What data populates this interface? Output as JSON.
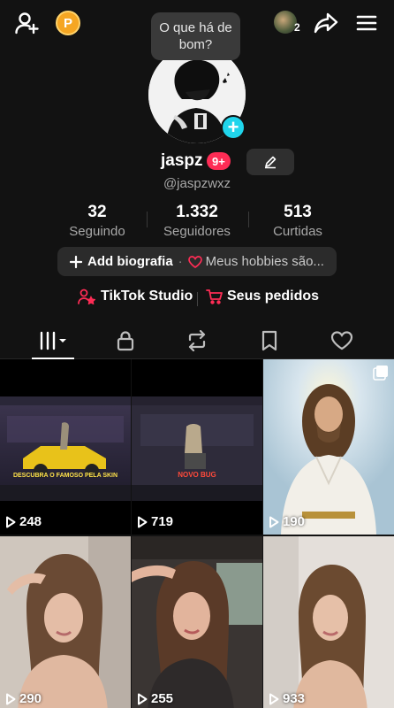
{
  "topbar": {
    "coin_label": "P",
    "bubble_text": "O que há de bom?",
    "notification_count": "2"
  },
  "profile": {
    "username": "jaspz",
    "badge": "9+",
    "handle": "@jaspzwxz"
  },
  "stats": [
    {
      "value": "32",
      "label": "Seguindo"
    },
    {
      "value": "1.332",
      "label": "Seguidores"
    },
    {
      "value": "513",
      "label": "Curtidas"
    }
  ],
  "bio": {
    "add_label": "Add biografia",
    "hobbies_label": "Meus hobbies são..."
  },
  "links": {
    "studio_label": "TikTok Studio",
    "orders_label": "Seus pedidos"
  },
  "game_texts": {
    "v1": "DESCUBRA O FAMOSO PELA SKIN",
    "v2": "NOVO BUG"
  },
  "videos": [
    {
      "views": "248"
    },
    {
      "views": "719"
    },
    {
      "views": "190"
    },
    {
      "views": "290"
    },
    {
      "views": "255"
    },
    {
      "views": "933"
    }
  ],
  "colors": {
    "background": "#121212",
    "accent_red": "#fe2c55",
    "accent_cyan": "#20d5ec",
    "coin": "#f5a623"
  }
}
